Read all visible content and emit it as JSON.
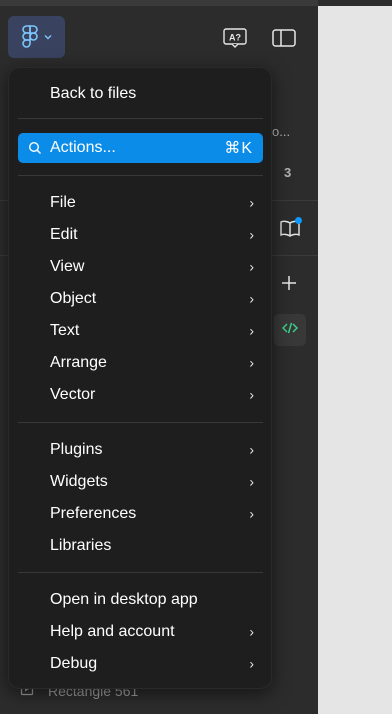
{
  "panel": {
    "partial_label": "o...",
    "partial_count": "3",
    "layer_name": "Rectangle 561"
  },
  "menu": {
    "back": "Back to files",
    "actions": {
      "label": "Actions...",
      "shortcut": "⌘K"
    },
    "group1": [
      {
        "label": "File"
      },
      {
        "label": "Edit"
      },
      {
        "label": "View"
      },
      {
        "label": "Object"
      },
      {
        "label": "Text"
      },
      {
        "label": "Arrange"
      },
      {
        "label": "Vector"
      }
    ],
    "group2": [
      {
        "label": "Plugins"
      },
      {
        "label": "Widgets"
      },
      {
        "label": "Preferences"
      },
      {
        "label": "Libraries"
      }
    ],
    "group3": [
      {
        "label": "Open in desktop app"
      },
      {
        "label": "Help and account"
      },
      {
        "label": "Debug"
      }
    ]
  },
  "colors": {
    "accent": "#0c8ce9",
    "menu_bg": "#1e1e1e",
    "panel_bg": "#2c2c2c",
    "figma_button_bg": "#394360"
  },
  "icons": [
    "figma-logo-icon",
    "chevron-down-icon",
    "auto-translate-icon",
    "sidebar-toggle-icon",
    "book-icon",
    "plus-icon",
    "code-icon",
    "search-icon",
    "chevron-right-icon",
    "frame-icon"
  ]
}
